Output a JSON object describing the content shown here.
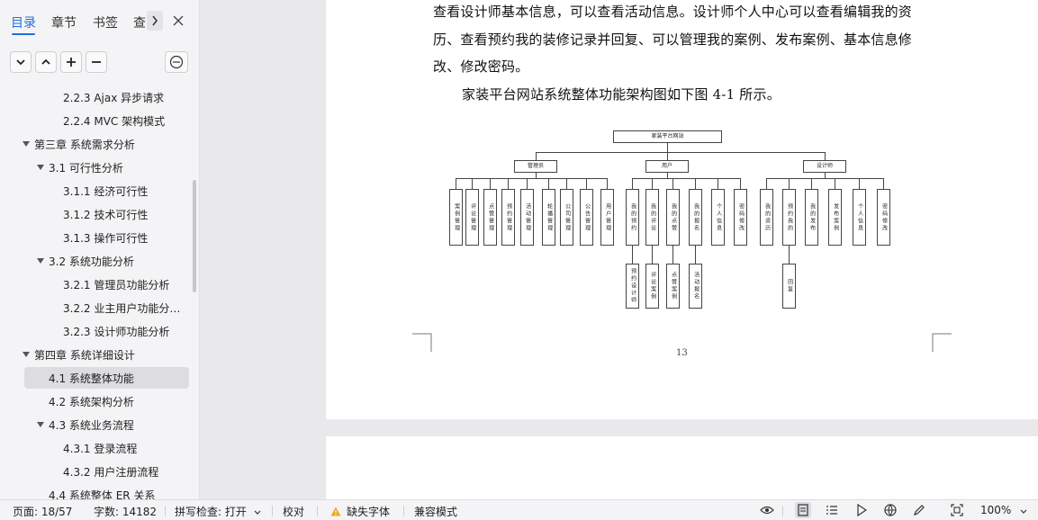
{
  "sidebar": {
    "tabs": [
      {
        "label": "目录"
      },
      {
        "label": "章节"
      },
      {
        "label": "书签"
      },
      {
        "label": "查"
      }
    ],
    "toc": [
      {
        "label": "2.2.3 Ajax 异步请求",
        "level": 3,
        "expandable": false
      },
      {
        "label": "2.2.4 MVC 架构模式",
        "level": 3,
        "expandable": false
      },
      {
        "label": "第三章  系统需求分析",
        "level": 1,
        "expandable": true
      },
      {
        "label": "3.1  可行性分析",
        "level": 2,
        "expandable": true
      },
      {
        "label": "3.1.1  经济可行性",
        "level": 3,
        "expandable": false
      },
      {
        "label": "3.1.2  技术可行性",
        "level": 3,
        "expandable": false
      },
      {
        "label": "3.1.3  操作可行性",
        "level": 3,
        "expandable": false
      },
      {
        "label": "3.2  系统功能分析",
        "level": 2,
        "expandable": true
      },
      {
        "label": "3.2.1  管理员功能分析",
        "level": 3,
        "expandable": false
      },
      {
        "label": "3.2.2  业主用户功能分…",
        "level": 3,
        "expandable": false
      },
      {
        "label": "3.2.3  设计师功能分析",
        "level": 3,
        "expandable": false
      },
      {
        "label": "第四章  系统详细设计",
        "level": 1,
        "expandable": true
      },
      {
        "label": "4.1  系统整体功能",
        "level": 2,
        "expandable": false,
        "selected": true
      },
      {
        "label": "4.2  系统架构分析",
        "level": 2,
        "expandable": false
      },
      {
        "label": "4.3  系统业务流程",
        "level": 2,
        "expandable": true
      },
      {
        "label": "4.3.1  登录流程",
        "level": 3,
        "expandable": false
      },
      {
        "label": "4.3.2  用户注册流程",
        "level": 3,
        "expandable": false
      },
      {
        "label": "4.4  系统整体 ER 关系",
        "level": 2,
        "expandable": false
      }
    ]
  },
  "document": {
    "paragraphs": [
      "查看设计师基本信息，可以查看活动信息。设计师个人中心可以查看编辑我的资",
      "历、查看预约我的装修记录并回复、可以管理我的案例、发布案例、基本信息修",
      "改、修改密码。",
      "家装平台网站系统整体功能架构图如下图 4-1 所示。"
    ],
    "diagram": {
      "root": "家装平台网站",
      "roles": [
        "管理员",
        "用户",
        "设计师"
      ],
      "admin_items": [
        "案例管理",
        "评论管理",
        "点赞管理",
        "预约管理",
        "活动管理",
        "轮播管理",
        "公司管理",
        "公告管理",
        "用户管理"
      ],
      "user_items": [
        "我的预约",
        "我的评论",
        "我的点赞",
        "我的报名",
        "个人信息",
        "密码修改"
      ],
      "designer_items": [
        "我的资历",
        "预约我的",
        "我的发布",
        "发布案例",
        "个人信息",
        "密码修改"
      ],
      "user_sub_items": [
        "预约设计师",
        "评论案例",
        "点赞案例",
        "活动报名"
      ],
      "designer_sub_items": [
        "回复"
      ]
    },
    "page_number": "13"
  },
  "statusbar": {
    "page": "页面: 18/57",
    "words": "字数: 14182",
    "spell": "拼写检查: 打开",
    "proof": "校对",
    "missing_font": "缺失字体",
    "compat": "兼容模式",
    "zoom": "100%"
  }
}
